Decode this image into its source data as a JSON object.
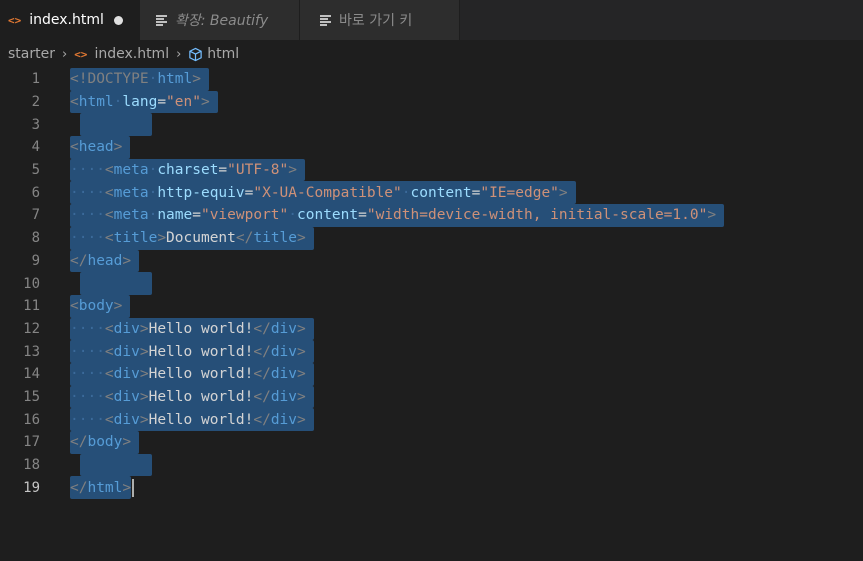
{
  "tabs": [
    {
      "label": "index.html",
      "icon": "html-code-icon",
      "modified": true
    },
    {
      "label": "확장: Beautify",
      "icon": "preview-lines-icon"
    },
    {
      "label": "바로 가기 키",
      "icon": "preview-lines-icon"
    }
  ],
  "breadcrumb": [
    "starter",
    "index.html",
    "html"
  ],
  "editor": {
    "line_numbers": [
      "1",
      "2",
      "3",
      "4",
      "5",
      "6",
      "7",
      "8",
      "9",
      "10",
      "11",
      "12",
      "13",
      "14",
      "15",
      "16",
      "17",
      "18",
      "19"
    ],
    "current_line": "19",
    "tokens": {
      "doctype": "<!DOCTYPE",
      "html": "html",
      "lang": "lang",
      "en": "\"en\"",
      "head": "head",
      "meta": "meta",
      "charset": "charset",
      "utf8": "\"UTF-8\"",
      "http_equiv": "http-equiv",
      "xua": "\"X-UA-Compatible\"",
      "content": "content",
      "ie_edge": "\"IE=edge\"",
      "name": "name",
      "viewport": "\"viewport\"",
      "vp_content": "\"width=device-width, initial-scale=1.0\"",
      "title": "title",
      "doc_text": "Document",
      "body": "body",
      "div": "div",
      "hello": "Hello world!"
    }
  },
  "colors": {
    "selection": "#264f78",
    "tag_name": "#569cd6",
    "attribute": "#9cdcfe",
    "string": "#ce9178"
  }
}
